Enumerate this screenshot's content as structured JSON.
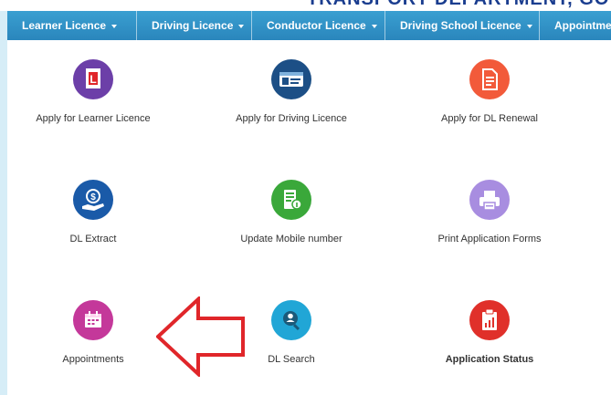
{
  "header": {
    "title": "TRANSPORT DEPARTMENT, GOVERNMENT"
  },
  "nav": [
    {
      "label": "Learner Licence"
    },
    {
      "label": "Driving Licence"
    },
    {
      "label": "Conductor Licence"
    },
    {
      "label": "Driving School Licence"
    },
    {
      "label": "Appointments"
    }
  ],
  "tiles": [
    {
      "label": "Apply for Learner Licence",
      "icon": "learner-licence-icon",
      "color": "#6c3fa8"
    },
    {
      "label": "Apply for Driving Licence",
      "icon": "driving-licence-card-icon",
      "color": "#1c4f86"
    },
    {
      "label": "Apply for DL Renewal",
      "icon": "document-icon",
      "color": "#f25a3a"
    },
    {
      "label": "DL Extract",
      "icon": "money-hand-icon",
      "color": "#1a5aa8"
    },
    {
      "label": "Update Mobile number",
      "icon": "mobile-update-icon",
      "color": "#3aa83a"
    },
    {
      "label": "Print Application Forms",
      "icon": "printer-icon",
      "color": "#a88de0"
    },
    {
      "label": "Appointments",
      "icon": "calendar-icon",
      "color": "#c4389a"
    },
    {
      "label": "DL Search",
      "icon": "user-search-icon",
      "color": "#21a6d6"
    },
    {
      "label": "Application Status",
      "icon": "status-clipboard-icon",
      "color": "#e0302a"
    }
  ],
  "annotation": {
    "icon": "red-arrow-left-icon",
    "color": "#e0262a"
  }
}
